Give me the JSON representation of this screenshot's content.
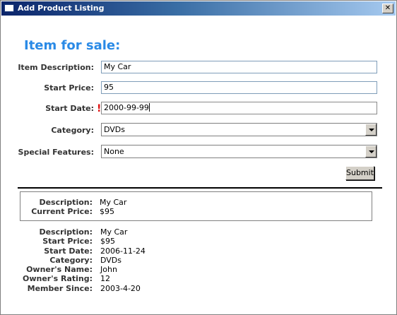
{
  "window": {
    "title": "Add Product Listing",
    "close_glyph": "✕"
  },
  "form": {
    "heading": "Item for sale:",
    "description_label": "Item Description:",
    "description_value": "My Car",
    "price_label": "Start Price:",
    "price_value": "95",
    "date_label": "Start Date:",
    "date_value": "2000-99-99",
    "date_error_mark": "!",
    "category_label": "Category:",
    "category_value": "DVDs",
    "features_label": "Special Features:",
    "features_value": "None",
    "submit_label": "Submit"
  },
  "summary": {
    "description_label": "Description:",
    "description_value": "My Car",
    "price_label": "Current Price:",
    "price_value": "$95"
  },
  "details": {
    "description_label": "Description:",
    "description_value": "My Car",
    "price_label": "Start Price:",
    "price_value": "$95",
    "date_label": "Start Date:",
    "date_value": "2006-11-24",
    "category_label": "Category:",
    "category_value": "DVDs",
    "owner_label": "Owner's Name:",
    "owner_value": "John",
    "rating_label": "Owner's Rating:",
    "rating_value": "12",
    "member_label": "Member Since:",
    "member_value": "2003-4-20"
  },
  "colors": {
    "heading": "#2a8ae6",
    "error": "#e01010",
    "titlebar_start": "#0a246a",
    "titlebar_end": "#a6caf0"
  }
}
